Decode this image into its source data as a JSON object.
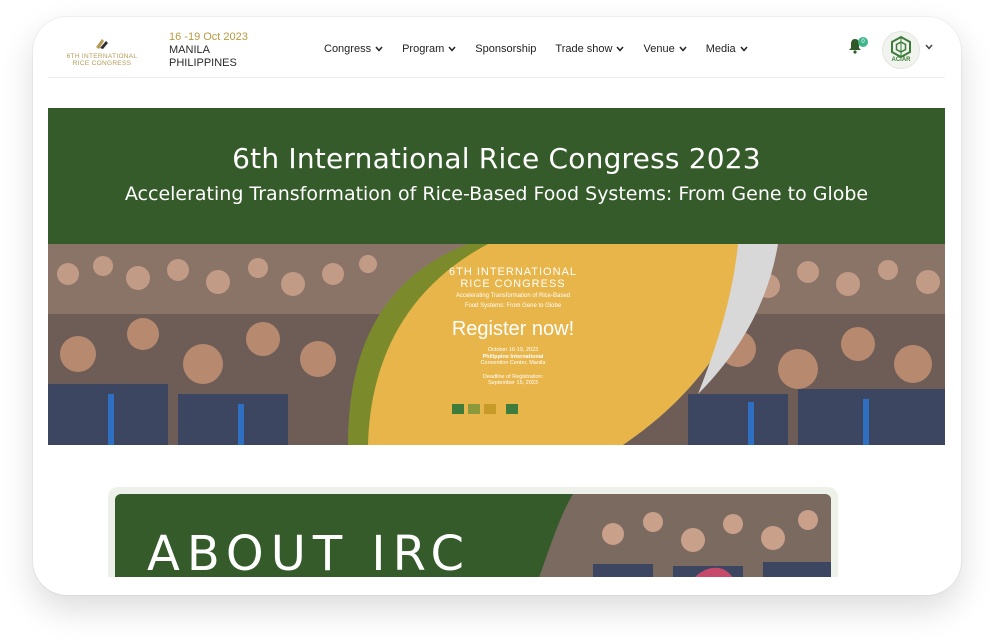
{
  "header": {
    "logo": {
      "line1": "6TH INTERNATIONAL",
      "line2": "RICE CONGRESS"
    },
    "date": "16 -19 Oct 2023",
    "city": "MANILA",
    "country": "PHILIPPINES",
    "nav": [
      "Congress",
      "Program",
      "Sponsorship",
      "Trade show",
      "Venue",
      "Media"
    ],
    "notification_count": "0",
    "partner_logo": "ACIAR"
  },
  "banner": {
    "title": "6th International Rice Congress 2023",
    "subtitle": "Accelerating Transformation of Rice-Based Food Systems: From Gene to Globe"
  },
  "promo": {
    "title_line1": "6TH INTERNATIONAL",
    "title_line2": "RICE CONGRESS",
    "sub_line1": "Accelerating Transformation of Rice-Based",
    "sub_line2": "Food Systems: From Gene to Globe",
    "register": "Register now!",
    "date": "October 16-19, 2023",
    "venue1": "Philippine International",
    "venue2": "Convention Center, Manila",
    "deadline1": "Deadline of Registration:",
    "deadline2": "September 15, 2023"
  },
  "about": {
    "title": "ABOUT IRC"
  },
  "colors": {
    "green": "#355b2a",
    "gold": "#e8b54a",
    "olive": "#7a8a2a",
    "accent_text": "#b89a3e",
    "badge": "#3fb58c"
  },
  "icons": [
    "chevron-down-icon",
    "bell-icon",
    "rice-logo-icon"
  ]
}
